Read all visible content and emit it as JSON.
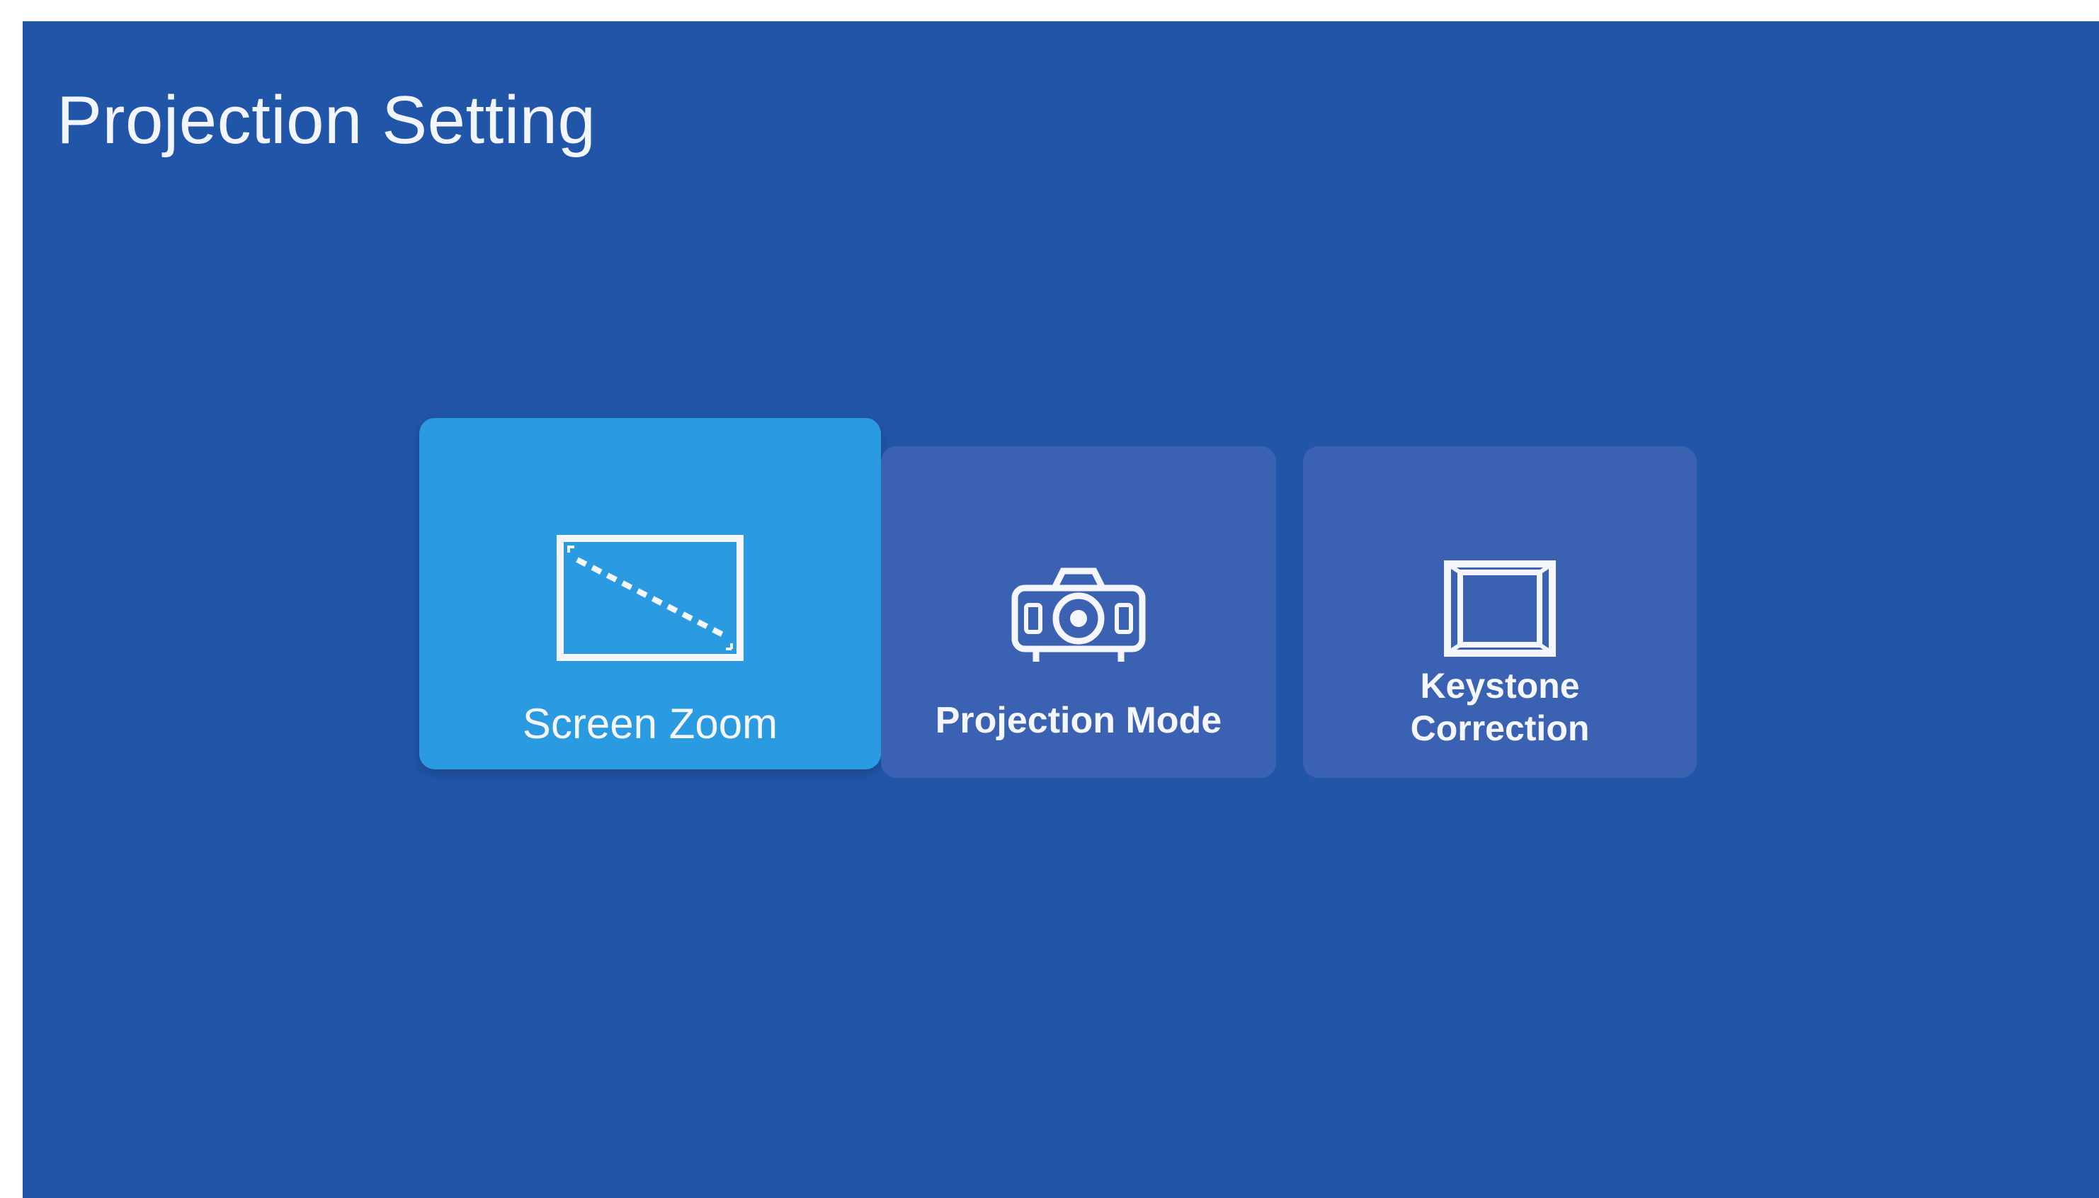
{
  "page": {
    "title": "Projection Setting"
  },
  "tiles": [
    {
      "label": "Screen Zoom",
      "icon": "screen-zoom-icon",
      "focused": true
    },
    {
      "label": "Projection Mode",
      "icon": "projector-icon",
      "focused": false
    },
    {
      "label": "Keystone\nCorrection",
      "icon": "keystone-icon",
      "focused": false
    }
  ],
  "colors": {
    "background": "#2155a8",
    "tile": "#3b62b2",
    "tile_focused": "#2a9be0",
    "text": "#f4f6fc"
  }
}
